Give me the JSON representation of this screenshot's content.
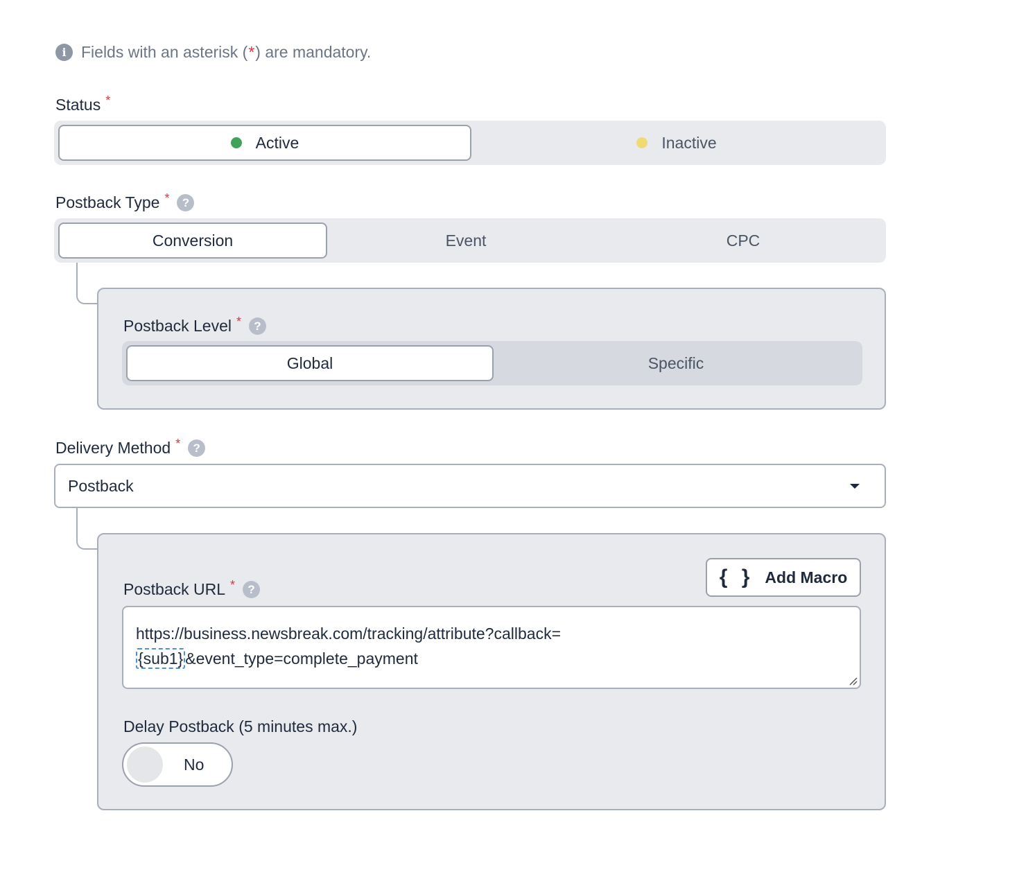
{
  "notice": {
    "before": "Fields with an asterisk (",
    "star": "*",
    "after": ") are mandatory."
  },
  "required_mark": "*",
  "help_glyph": "?",
  "info_glyph": "i",
  "status": {
    "label": "Status",
    "options": [
      {
        "label": "Active",
        "dot_color": "#3fa35a",
        "selected": true
      },
      {
        "label": "Inactive",
        "dot_color": "#f2d978",
        "selected": false
      }
    ]
  },
  "postback_type": {
    "label": "Postback Type",
    "options": [
      {
        "label": "Conversion",
        "selected": true
      },
      {
        "label": "Event",
        "selected": false
      },
      {
        "label": "CPC",
        "selected": false
      }
    ]
  },
  "postback_level": {
    "label": "Postback Level",
    "options": [
      {
        "label": "Global",
        "selected": true
      },
      {
        "label": "Specific",
        "selected": false
      }
    ]
  },
  "delivery_method": {
    "label": "Delivery Method",
    "value": "Postback"
  },
  "postback_url": {
    "label": "Postback URL",
    "add_macro_label": "Add Macro",
    "add_macro_icon": "{ }",
    "line1": "https://business.newsbreak.com/tracking/attribute?callback=",
    "macro": "{sub1}",
    "line2_rest": "&event_type=complete_payment"
  },
  "delay_postback": {
    "label": "Delay Postback (5 minutes max.)",
    "toggle_value": "No"
  }
}
